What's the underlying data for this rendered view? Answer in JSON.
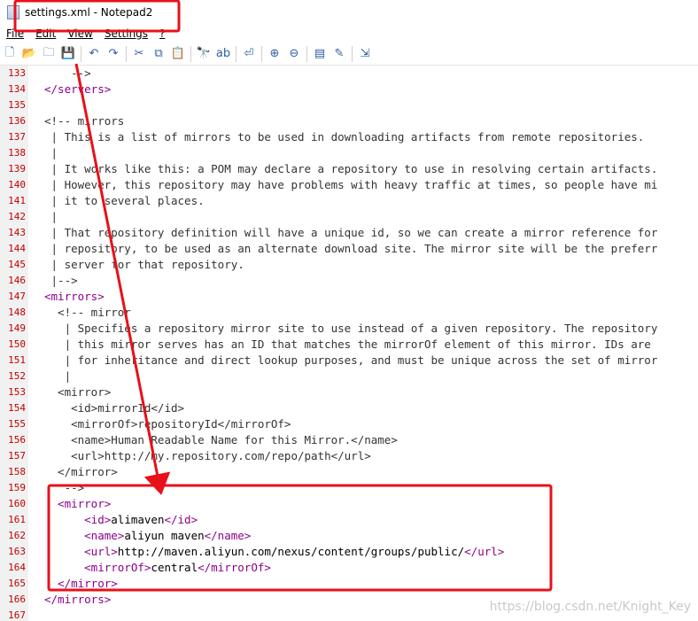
{
  "window": {
    "title": "settings.xml - Notepad2"
  },
  "menu": [
    "File",
    "Edit",
    "View",
    "Settings",
    "?"
  ],
  "toolbar": [
    {
      "name": "new-icon",
      "glyph": "🗋"
    },
    {
      "name": "open-icon",
      "glyph": "📂"
    },
    {
      "name": "browse-icon",
      "glyph": "🗀"
    },
    {
      "name": "save-icon",
      "glyph": "💾"
    },
    {
      "sep": true
    },
    {
      "name": "undo-icon",
      "glyph": "↶"
    },
    {
      "name": "redo-icon",
      "glyph": "↷"
    },
    {
      "sep": true
    },
    {
      "name": "cut-icon",
      "glyph": "✂"
    },
    {
      "name": "copy-icon",
      "glyph": "⧉"
    },
    {
      "name": "paste-icon",
      "glyph": "📋"
    },
    {
      "sep": true
    },
    {
      "name": "find-icon",
      "glyph": "🔭"
    },
    {
      "name": "replace-icon",
      "glyph": "ab"
    },
    {
      "sep": true
    },
    {
      "name": "wordwrap-icon",
      "glyph": "⏎"
    },
    {
      "sep": true
    },
    {
      "name": "zoom-in-icon",
      "glyph": "⊕"
    },
    {
      "name": "zoom-out-icon",
      "glyph": "⊖"
    },
    {
      "sep": true
    },
    {
      "name": "scheme-icon",
      "glyph": "▤"
    },
    {
      "name": "customize-icon",
      "glyph": "✎"
    },
    {
      "sep": true
    },
    {
      "name": "exit-icon",
      "glyph": "⇲"
    }
  ],
  "lines": [
    {
      "n": "133",
      "segs": [
        {
          "c": "cmt",
          "t": "    -->"
        }
      ]
    },
    {
      "n": "134",
      "segs": [
        {
          "c": "tag",
          "t": "</servers>"
        }
      ]
    },
    {
      "n": "135",
      "segs": []
    },
    {
      "n": "136",
      "segs": [
        {
          "c": "cmt",
          "t": "<!-- mirrors"
        }
      ]
    },
    {
      "n": "137",
      "segs": [
        {
          "c": "cmt",
          "t": " | This is a list of mirrors to be used in downloading artifacts from remote repositories."
        }
      ]
    },
    {
      "n": "138",
      "segs": [
        {
          "c": "cmt",
          "t": " |"
        }
      ]
    },
    {
      "n": "139",
      "segs": [
        {
          "c": "cmt",
          "t": " | It works like this: a POM may declare a repository to use in resolving certain artifacts."
        }
      ]
    },
    {
      "n": "140",
      "segs": [
        {
          "c": "cmt",
          "t": " | However, this repository may have problems with heavy traffic at times, so people have mi"
        }
      ]
    },
    {
      "n": "141",
      "segs": [
        {
          "c": "cmt",
          "t": " | it to several places."
        }
      ]
    },
    {
      "n": "142",
      "segs": [
        {
          "c": "cmt",
          "t": " |"
        }
      ]
    },
    {
      "n": "143",
      "segs": [
        {
          "c": "cmt",
          "t": " | That repository definition will have a unique id, so we can create a mirror reference for"
        }
      ]
    },
    {
      "n": "144",
      "segs": [
        {
          "c": "cmt",
          "t": " | repository, to be used as an alternate download site. The mirror site will be the preferr"
        }
      ]
    },
    {
      "n": "145",
      "segs": [
        {
          "c": "cmt",
          "t": " | server for that repository."
        }
      ]
    },
    {
      "n": "146",
      "segs": [
        {
          "c": "cmt",
          "t": " |-->"
        }
      ]
    },
    {
      "n": "147",
      "segs": [
        {
          "c": "tag",
          "t": "<mirrors>"
        }
      ]
    },
    {
      "n": "148",
      "segs": [
        {
          "c": "cmt",
          "t": "  <!-- mirror"
        }
      ]
    },
    {
      "n": "149",
      "segs": [
        {
          "c": "cmt",
          "t": "   | Specifies a repository mirror site to use instead of a given repository. The repository"
        }
      ]
    },
    {
      "n": "150",
      "segs": [
        {
          "c": "cmt",
          "t": "   | this mirror serves has an ID that matches the mirrorOf element of this mirror. IDs are"
        }
      ]
    },
    {
      "n": "151",
      "segs": [
        {
          "c": "cmt",
          "t": "   | for inheritance and direct lookup purposes, and must be unique across the set of mirror"
        }
      ]
    },
    {
      "n": "152",
      "segs": [
        {
          "c": "cmt",
          "t": "   |"
        }
      ]
    },
    {
      "n": "153",
      "segs": [
        {
          "c": "cmt",
          "t": "  <mirror>"
        }
      ]
    },
    {
      "n": "154",
      "segs": [
        {
          "c": "cmt",
          "t": "    <id>mirrorId</id>"
        }
      ]
    },
    {
      "n": "155",
      "segs": [
        {
          "c": "cmt",
          "t": "    <mirrorOf>repositoryId</mirrorOf>"
        }
      ]
    },
    {
      "n": "156",
      "segs": [
        {
          "c": "cmt",
          "t": "    <name>Human Readable Name for this Mirror.</name>"
        }
      ]
    },
    {
      "n": "157",
      "segs": [
        {
          "c": "cmt",
          "t": "    <url>http://my.repository.com/repo/path</url>"
        }
      ]
    },
    {
      "n": "158",
      "segs": [
        {
          "c": "cmt",
          "t": "  </mirror>"
        }
      ]
    },
    {
      "n": "159",
      "segs": [
        {
          "c": "cmt",
          "t": "   -->"
        }
      ]
    },
    {
      "n": "160",
      "segs": [
        {
          "c": "tag",
          "t": "  <mirror>"
        }
      ]
    },
    {
      "n": "161",
      "segs": [
        {
          "c": "tag",
          "t": "      <id>"
        },
        {
          "c": "txt",
          "t": "alimaven"
        },
        {
          "c": "tag",
          "t": "</id>"
        }
      ]
    },
    {
      "n": "162",
      "segs": [
        {
          "c": "tag",
          "t": "      <name>"
        },
        {
          "c": "txt",
          "t": "aliyun maven"
        },
        {
          "c": "tag",
          "t": "</name>"
        }
      ]
    },
    {
      "n": "163",
      "segs": [
        {
          "c": "tag",
          "t": "      <url>"
        },
        {
          "c": "txt",
          "t": "http://maven.aliyun.com/nexus/content/groups/public/"
        },
        {
          "c": "tag",
          "t": "</url>"
        }
      ]
    },
    {
      "n": "164",
      "segs": [
        {
          "c": "tag",
          "t": "      <mirrorOf>"
        },
        {
          "c": "txt",
          "t": "central"
        },
        {
          "c": "tag",
          "t": "</mirrorOf>"
        }
      ]
    },
    {
      "n": "165",
      "segs": [
        {
          "c": "tag",
          "t": "  </mirror>"
        }
      ]
    },
    {
      "n": "166",
      "segs": [
        {
          "c": "tag",
          "t": "</mirrors>"
        }
      ]
    },
    {
      "n": "167",
      "segs": []
    }
  ],
  "watermark": "https://blog.csdn.net/Knight_Key",
  "colors": {
    "line_number": "#c00000",
    "tag": "#8b008b",
    "annotation": "#e8101a",
    "gutter": "#f1f1f1"
  }
}
